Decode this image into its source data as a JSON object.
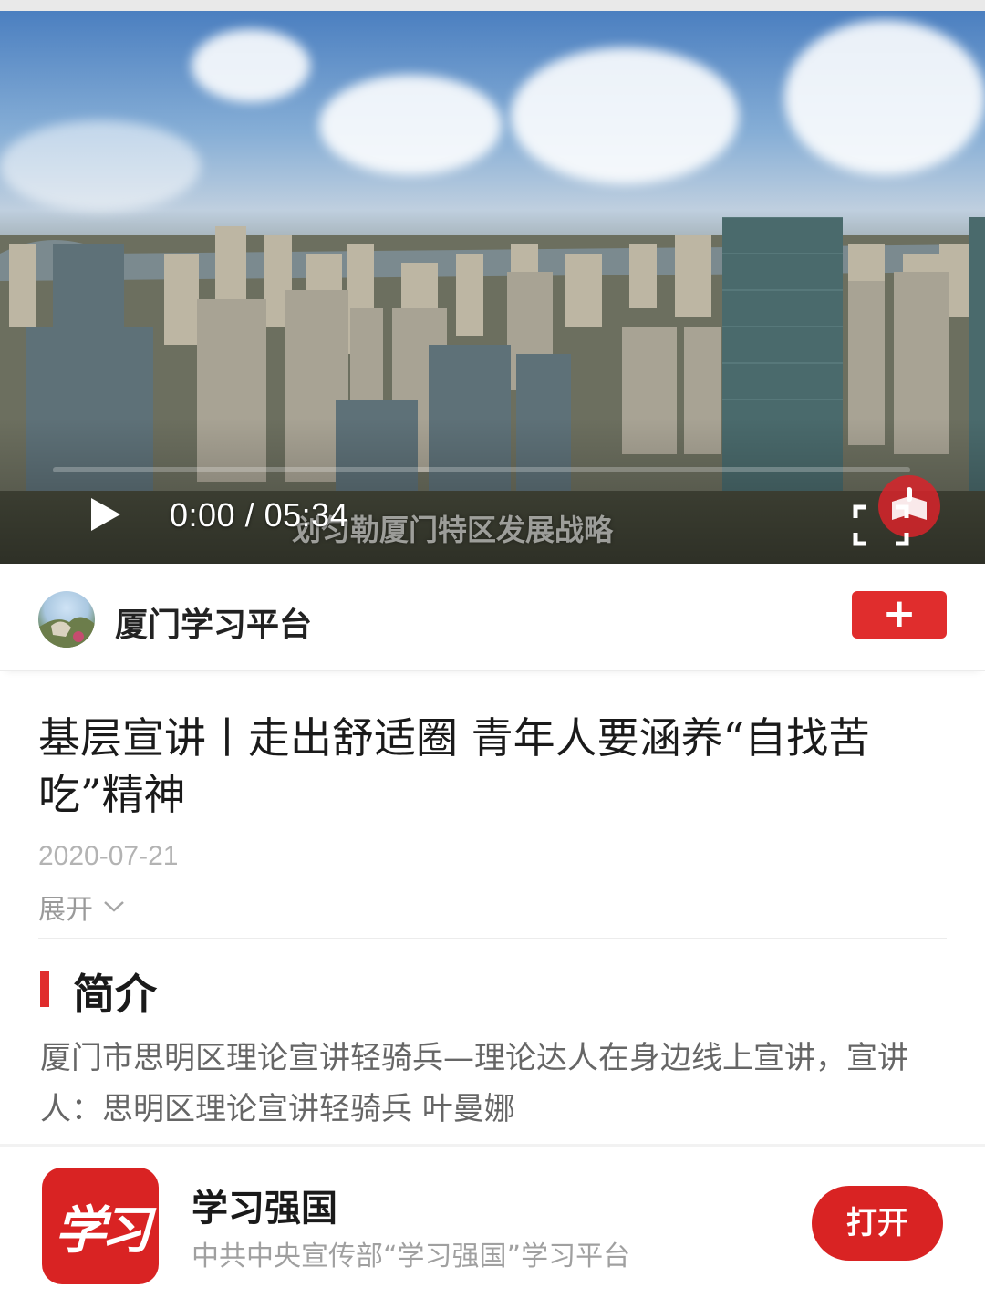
{
  "video": {
    "current_time": "0:00",
    "separator": "/",
    "duration": "05:34",
    "caption": "划匀勒厦门特区发展战略",
    "progress": 0
  },
  "account": {
    "name": "厦门学习平台",
    "follow_label": "+"
  },
  "article": {
    "title": "基层宣讲丨走出舒适圈 青年人要涵养“自找苦吃”精神",
    "date": "2020-07-21",
    "expand_label": "展开"
  },
  "intro": {
    "heading": "简介",
    "text": "厦门市思明区理论宣讲轻骑兵—理论达人在身边线上宣讲，宣讲人：思明区理论宣讲轻骑兵 叶曼娜"
  },
  "app_banner": {
    "icon_text": "学习",
    "name": "学习强国",
    "description": "中共中央宣传部“学习强国”学习平台",
    "open_label": "打开"
  },
  "colors": {
    "accent_red": "#e02d2d",
    "app_red": "#d92323"
  }
}
